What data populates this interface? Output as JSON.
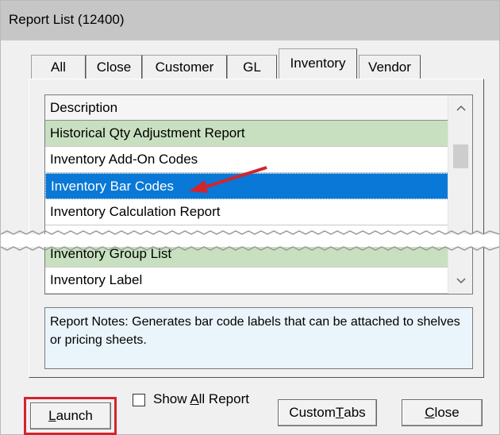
{
  "window": {
    "title": "Report List (12400)"
  },
  "tabs": [
    {
      "label": "All"
    },
    {
      "label": "Close"
    },
    {
      "label": "Customer"
    },
    {
      "label": "GL"
    },
    {
      "label": "Inventory"
    },
    {
      "label": "Vendor"
    }
  ],
  "active_tab": "Inventory",
  "list": {
    "header": "Description",
    "rows": [
      {
        "label": "Historical Qty Adjustment Report",
        "style": "green"
      },
      {
        "label": "Inventory Add-On Codes",
        "style": "white"
      },
      {
        "label": "Inventory Bar Codes",
        "style": "selected"
      },
      {
        "label": "Inventory Calculation Report",
        "style": "white"
      },
      {
        "label": "Inventory Group List",
        "style": "green"
      },
      {
        "label": "Inventory Label",
        "style": "white"
      }
    ]
  },
  "notes": {
    "text": "Report Notes:  Generates bar code labels that can be attached to shelves or pricing sheets."
  },
  "buttons": {
    "launch_prefix": "",
    "launch_underline": "L",
    "launch_rest": "aunch",
    "show_all_prefix": "Show ",
    "show_all_underline": "A",
    "show_all_rest": "ll Report",
    "custom_tabs_prefix": "Custom ",
    "custom_tabs_underline": "T",
    "custom_tabs_rest": "abs",
    "close_prefix": "",
    "close_underline": "C",
    "close_rest": "lose"
  },
  "colors": {
    "selected_row": "#0a78d6",
    "green_row": "#c8e0c0",
    "highlight_box": "#d4242d",
    "arrow": "#d4242d"
  }
}
